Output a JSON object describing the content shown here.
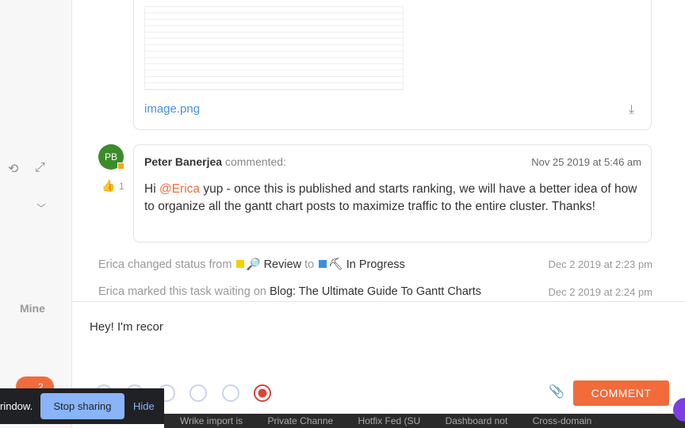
{
  "sidebar": {
    "tab_mine": "Mine",
    "icons": [
      "history-icon",
      "expand-icon",
      "chevron-down-icon"
    ],
    "badge": "2"
  },
  "attachment": {
    "filename": "image.png"
  },
  "comment": {
    "initials": "PB",
    "author": "Peter Banerjea",
    "verb": "commented:",
    "time": "Nov 25 2019 at 5:46 am",
    "likes": "1",
    "greeting": "Hi ",
    "mention": "@Erica",
    "text": " yup - once this is published and starts ranking, we will have a better idea of how to organize all the gantt chart posts to maximize traffic to the entire cluster. Thanks!"
  },
  "activity": [
    {
      "prefix": "Erica changed status from",
      "from": "Review",
      "to_word": "to",
      "to": "In Progress",
      "time": "Dec 2 2019 at 2:23 pm",
      "from_color": "#f5d000",
      "to_color": "#3a8ee6"
    },
    {
      "prefix": "Erica marked this task waiting on",
      "target": "Blog: The Ultimate Guide To Gantt Charts",
      "time": "Dec 2 2019 at 2:24 pm"
    }
  ],
  "composer": {
    "value": "Hey! I'm recor",
    "submit": "COMMENT"
  },
  "share_bar": {
    "text": "rindow.",
    "stop": "Stop sharing",
    "hide": "Hide"
  },
  "taskbar": [
    "Wrike import is",
    "Private Channe",
    "Hotfix Fed (SU",
    "Dashboard not",
    "Cross-domain"
  ],
  "colors": {
    "accent": "#f26b3a",
    "link": "#4a90e2"
  }
}
